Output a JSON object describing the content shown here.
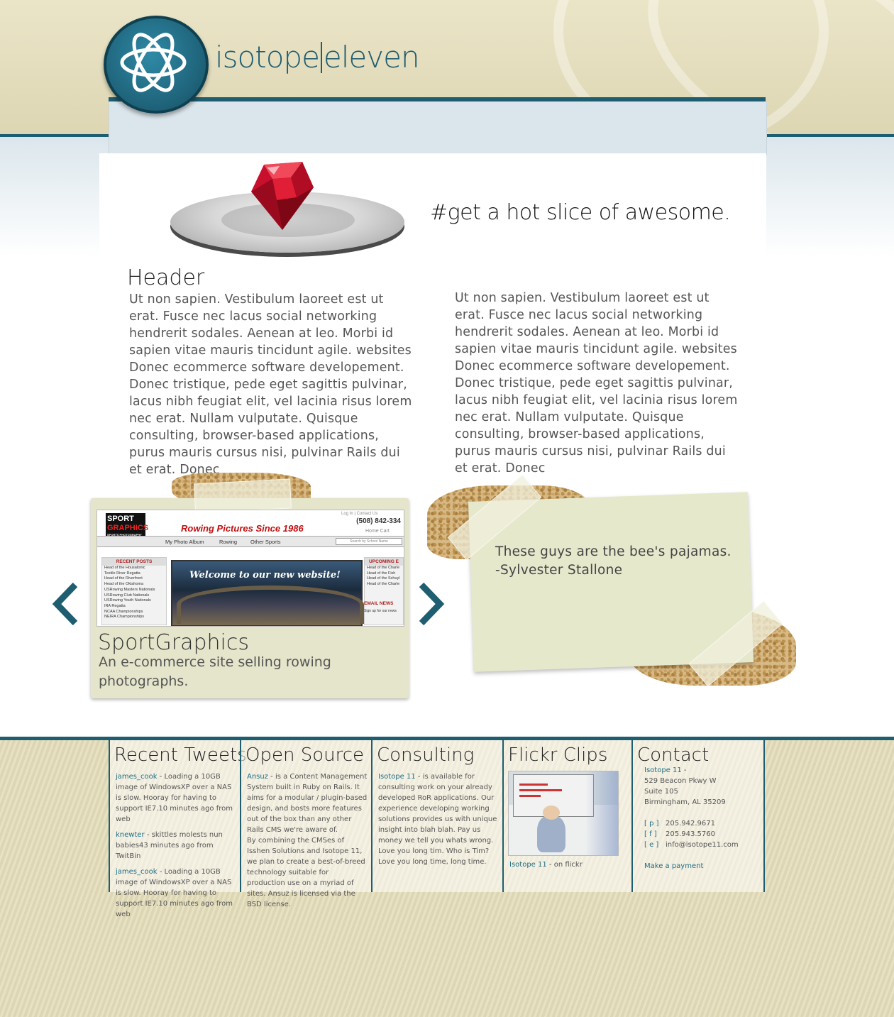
{
  "brand": {
    "left": "isotope",
    "right": "eleven"
  },
  "hero": {
    "tagline": "#get a hot slice of awesome."
  },
  "content": {
    "header": "Header",
    "left_text": "Ut non sapien. Vestibulum laoreet est ut erat. Fusce nec lacus social networking hendrerit sodales. Aenean at leo. Morbi id sapien vitae mauris tincidunt agile. websites Donec ecommerce software developement. Donec tristique, pede eget sagittis pulvinar, lacus nibh feugiat elit, vel lacinia risus lorem nec erat. Nullam vulputate. Quisque consulting, browser-based applications, purus mauris cursus nisi, pulvinar Rails dui et erat. Donec",
    "right_text": "Ut non sapien. Vestibulum laoreet est ut erat. Fusce nec lacus social networking hendrerit sodales. Aenean at leo. Morbi id sapien vitae mauris tincidunt agile. websites Donec ecommerce software developement. Donec tristique, pede eget sagittis pulvinar, lacus nibh feugiat elit, vel lacinia risus lorem nec erat. Nullam vulputate. Quisque consulting, browser-based applications, purus mauris cursus nisi, pulvinar Rails dui et erat. Donec"
  },
  "portfolio": {
    "title": "SportGraphics",
    "description": "An e-commerce site selling rowing photographs.",
    "screenshot": {
      "logo_top": "SPORT",
      "logo_bottom": "GRAPHICS",
      "logo_sub": "SPORTS PHOTOGRAPHY",
      "headline": "Rowing Pictures Since 1986",
      "phone": "(508) 842-334",
      "top_links": "Log In | Contact Us",
      "cart_links": "Home    Cart",
      "nav": [
        "My Photo Album",
        "Rowing",
        "Other Sports"
      ],
      "search_placeholder": "Search by School Name",
      "recent_posts_title": "RECENT POSTS",
      "recent_posts": [
        "Head of the Housatonic",
        "Textile River Regatta",
        "Head of the Riverfront",
        "Head of the Oklahoma",
        "USRowing Masters Nationals",
        "USRowing Club Nationals",
        "USRowing Youth Nationals",
        "IRA Regatta",
        "NCAA Championships",
        "NEIRA Championships"
      ],
      "banner": "Welcome to our new website!",
      "upcoming_title": "UPCOMING E",
      "upcoming": [
        "Head of the Charle",
        "Head of the Fish",
        "Head of the Schuyl",
        "Head of the Charle"
      ],
      "email_title": "EMAIL NEWS",
      "email_sub": "Sign up for our news"
    },
    "prev_icon": "chevron-left-icon",
    "next_icon": "chevron-right-icon"
  },
  "testimonial": {
    "quote": "These guys are the bee's pajamas.",
    "author": "-Sylvester Stallone"
  },
  "footer": {
    "tweets": {
      "title": "Recent Tweets",
      "items": [
        {
          "user": "james_cook",
          "text": " - Loading a 10GB image of WindowsXP over a NAS is slow. Hooray for having to support IE7.10 minutes ago from web"
        },
        {
          "user": "knewter",
          "text": " - skittles molests nun babies43 minutes ago from TwitBin"
        },
        {
          "user": "james_cook",
          "text": " - Loading a 10GB image of WindowsXP over a NAS is slow. Hooray for having to support IE7.10 minutes ago from web"
        }
      ]
    },
    "open_source": {
      "title": "Open Source",
      "link": "Ansuz",
      "text1": " - is a Content Management System built in Ruby on Rails. It aims for a modular / plugin-based design, and bosts more features out of the box than any other Rails CMS we're aware of.",
      "text2": "By combining the CMSes of Isshen Solutions and Isotope 11, we plan to create a best-of-breed technology suitable for production use on a myriad of sites. Ansuz is licensed via the BSD license."
    },
    "consulting": {
      "title": "Consulting",
      "link": "Isotope 11",
      "text": " - is available for consulting work on your already developed RoR applications. Our experience developing working solutions provides us with unique insight into blah blah. Pay us money we tell you whats wrong. Love you long tim. Who is Tim? Love you long time, long time."
    },
    "flickr": {
      "title": "Flickr Clips",
      "link": "Isotope 11",
      "caption": " - on flickr"
    },
    "contact": {
      "title": "Contact",
      "name": "Isotope 11",
      "name_suffix": " -",
      "address1": "529 Beacon Pkwy W",
      "address2": "Suite 105",
      "address3": "Birmingham, AL 35209",
      "phone_label": "[ p ]",
      "phone": "205.942.9671",
      "fax_label": "[ f ]",
      "fax": "205.943.5760",
      "email_label": "[ e ]",
      "email": "info@isotope11.com",
      "payment": "Make a payment"
    }
  },
  "colors": {
    "accent": "#1f5d70",
    "link": "#1f6e88",
    "beige": "#e5dfbf",
    "card": "#e5e5cb"
  }
}
